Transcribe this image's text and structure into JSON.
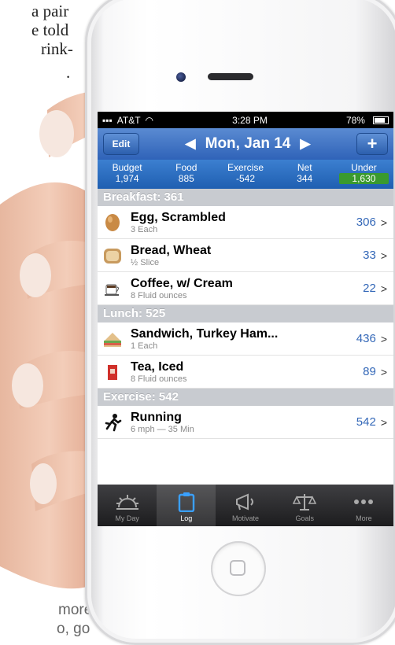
{
  "background": {
    "lines": [
      "a pair",
      "e told",
      "rink-",
      "."
    ],
    "bottom_lines": [
      "more",
      "o, go"
    ]
  },
  "status": {
    "carrier": "AT&T",
    "time": "3:28 PM",
    "battery": "78%"
  },
  "nav": {
    "edit": "Edit",
    "date": "Mon, Jan 14",
    "prev": "◀",
    "next": "▶",
    "add": "+"
  },
  "summary": [
    {
      "label": "Budget",
      "value": "1,974"
    },
    {
      "label": "Food",
      "value": "885"
    },
    {
      "label": "Exercise",
      "value": "-542"
    },
    {
      "label": "Net",
      "value": "344"
    },
    {
      "label": "Under",
      "value": "1,630"
    }
  ],
  "breakfast": {
    "header": "Breakfast: 361",
    "items": [
      {
        "name": "Egg, Scrambled",
        "qty": "3 Each",
        "cal": "306",
        "icon": "egg-icon"
      },
      {
        "name": "Bread, Wheat",
        "qty": "½ Slice",
        "cal": "33",
        "icon": "bread-icon"
      },
      {
        "name": "Coffee, w/ Cream",
        "qty": "8 Fluid ounces",
        "cal": "22",
        "icon": "coffee-icon"
      }
    ]
  },
  "lunch": {
    "header": "Lunch: 525",
    "items": [
      {
        "name": "Sandwich, Turkey Ham...",
        "qty": "1 Each",
        "cal": "436",
        "icon": "sandwich-icon"
      },
      {
        "name": "Tea, Iced",
        "qty": "8 Fluid ounces",
        "cal": "89",
        "icon": "tea-icon"
      }
    ]
  },
  "exercise": {
    "header": "Exercise: 542",
    "items": [
      {
        "name": "Running",
        "qty": "6 mph — 35 Min",
        "cal": "542",
        "icon": "running-icon"
      }
    ]
  },
  "tabs": [
    {
      "label": "My Day",
      "icon": "sunrise-icon"
    },
    {
      "label": "Log",
      "icon": "clipboard-icon"
    },
    {
      "label": "Motivate",
      "icon": "megaphone-icon"
    },
    {
      "label": "Goals",
      "icon": "scale-icon"
    },
    {
      "label": "More",
      "icon": "more-dots-icon"
    }
  ],
  "colors": {
    "nav_blue": "#2f63b8",
    "under_green": "#3a9a2e",
    "calorie_blue": "#3468b8",
    "section_gray": "#c8cbd0"
  }
}
